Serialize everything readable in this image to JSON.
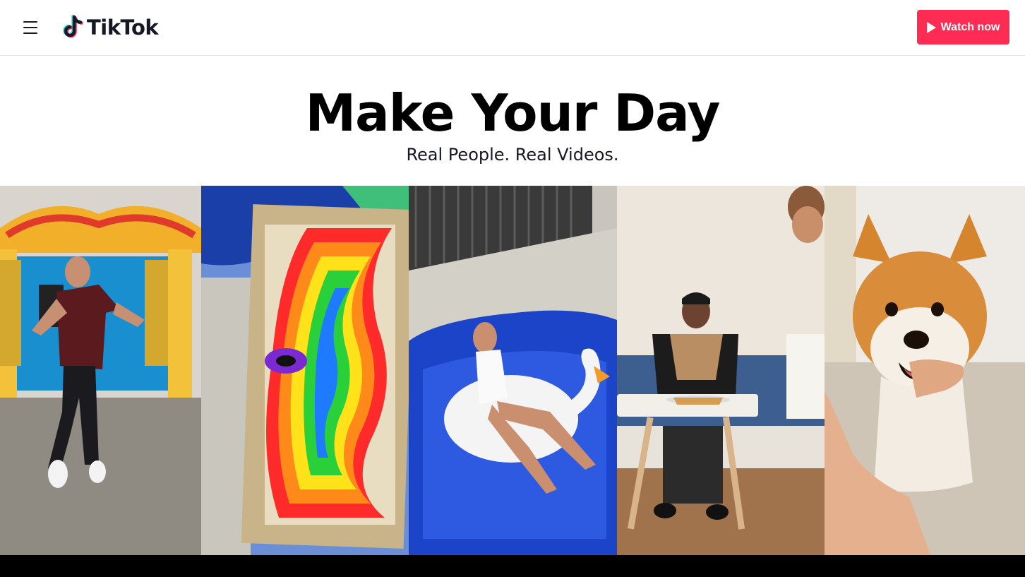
{
  "header": {
    "brand": "TikTok",
    "menu_icon": "hamburger-menu-icon",
    "logo_icon": "tiktok-note-icon",
    "cta_label": "Watch now",
    "cta_icon": "play-icon"
  },
  "hero": {
    "title": "Make Your Day",
    "subtitle": "Real People. Real Videos."
  },
  "videos": [
    {
      "subject": "man dancing under carnival stage"
    },
    {
      "subject": "rainbow paint pour art"
    },
    {
      "subject": "woman floating on swan in pool"
    },
    {
      "subject": "man eating at table with waiter"
    },
    {
      "subject": "shiba inu dog with thumbs up"
    }
  ],
  "colors": {
    "accent": "#fe2c55",
    "cyan": "#25f4ee",
    "text": "#161823"
  }
}
